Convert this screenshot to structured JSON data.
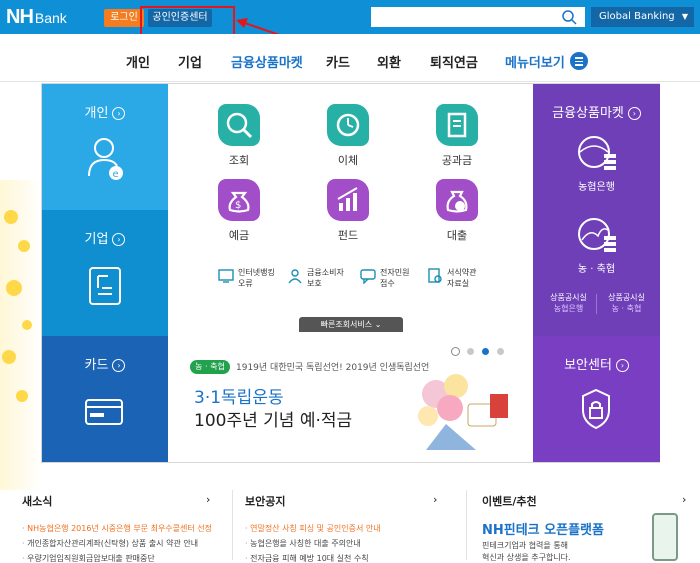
{
  "header": {
    "logo_nh": "NH",
    "logo_bank": "Bank",
    "login_label": "로그인",
    "cert_label": "공인인증센터",
    "search_placeholder": "",
    "global_label": "Global Banking",
    "colors": {
      "bar": "#0e8fd6",
      "login": "#f57c1f",
      "highlight": "#e3161b"
    }
  },
  "nav": {
    "items": [
      "개인",
      "기업",
      "금융상품마켓",
      "카드",
      "외환",
      "퇴직연금",
      "메뉴더보기"
    ],
    "active_color": "#1a73c9"
  },
  "left_panels": {
    "individual": "개인",
    "corporate": "기업",
    "card": "카드"
  },
  "services": {
    "row1": [
      "조회",
      "이체",
      "공과금"
    ],
    "row2": [
      "예금",
      "펀드",
      "대출"
    ],
    "small": [
      {
        "l1": "인터넷뱅킹",
        "l2": "오류"
      },
      {
        "l1": "금융소비자",
        "l2": "보호"
      },
      {
        "l1": "전자민원",
        "l2": "접수"
      },
      {
        "l1": "서식약관",
        "l2": "자료실"
      }
    ],
    "quick_label": "빠른조회서비스"
  },
  "market_panel": {
    "title": "금융상품마켓",
    "item1": "농협은행",
    "item2": "농 · 축협",
    "sub1_l1": "상품공시실",
    "sub1_l2": "농협은행",
    "sub2_l1": "상품공시실",
    "sub2_l2": "농 · 축협"
  },
  "security_panel": {
    "title": "보안센터"
  },
  "banner": {
    "badge": "농 · 축협",
    "subtitle": "1919년 대한민국 독립선언! 2019년 인생독립선언",
    "title1": "3·1독립운동",
    "title2": "100주년 기념 예·적금",
    "dots": 3,
    "active_dot": 2
  },
  "bottom": {
    "news": {
      "title": "새소식",
      "items": [
        "NH농협은행 2016년 시중은행 부문 최우수콜센터 선정",
        "개인종합자산관리계좌(신탁형) 상품 출시 약관 안내",
        "우량기업임직원회금압보대출 판매중단"
      ]
    },
    "security": {
      "title": "보안공지",
      "items": [
        "연말정산 사칭 피싱 및 공인인증서 안내",
        "농협은행을 사칭한 대출 주의안내",
        "전자금융 피해 예방 10대 실천 수칙"
      ]
    },
    "event": {
      "title": "이벤트/추천",
      "headline": "NH핀테크 오픈플랫폼",
      "desc1": "핀테크기업과 협력을 통해",
      "desc2": "혁신과 상생을 추구합니다."
    },
    "arrow": "›"
  }
}
